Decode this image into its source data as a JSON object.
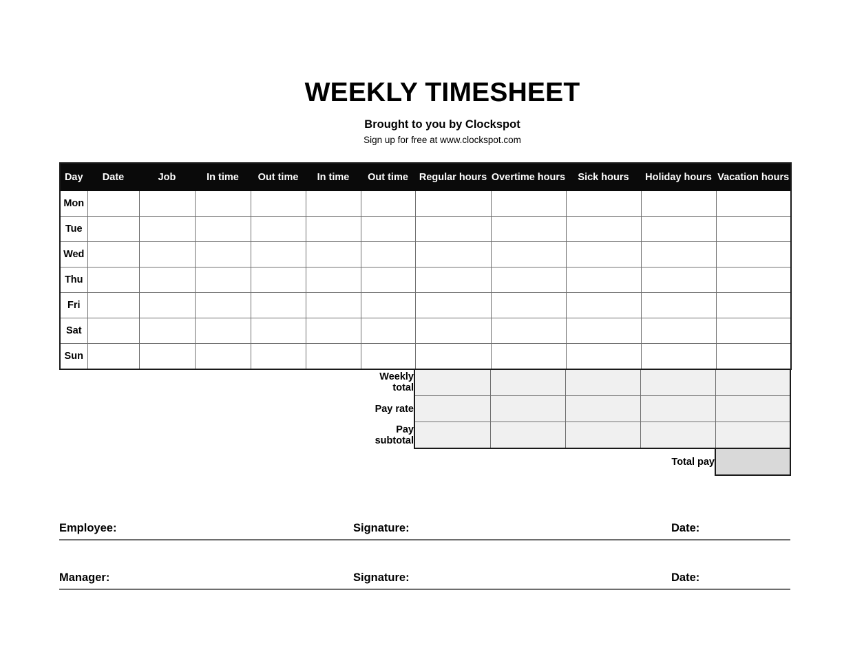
{
  "document": {
    "title": "WEEKLY TIMESHEET",
    "subtitle": "Brought to you by Clockspot",
    "tagline": "Sign up for free at www.clockspot.com"
  },
  "colors": {
    "header_background": "#0a0a0a",
    "header_text": "#ffffff",
    "grid_border": "#6e6e6e",
    "outline_border": "#1a1a1a",
    "summary_cell_fill": "#f0f0f0",
    "total_pay_fill": "#d9d9d9",
    "page_background": "#ffffff"
  },
  "table": {
    "columns": [
      "Day",
      "Date",
      "Job",
      "In time",
      "Out time",
      "In time",
      "Out time",
      "Regular hours",
      "Overtime hours",
      "Sick hours",
      "Holiday hours",
      "Vacation hours"
    ],
    "rows": [
      {
        "day": "Mon",
        "date": "",
        "job": "",
        "in_time_1": "",
        "out_time_1": "",
        "in_time_2": "",
        "out_time_2": "",
        "regular_hours": "",
        "overtime_hours": "",
        "sick_hours": "",
        "holiday_hours": "",
        "vacation_hours": ""
      },
      {
        "day": "Tue",
        "date": "",
        "job": "",
        "in_time_1": "",
        "out_time_1": "",
        "in_time_2": "",
        "out_time_2": "",
        "regular_hours": "",
        "overtime_hours": "",
        "sick_hours": "",
        "holiday_hours": "",
        "vacation_hours": ""
      },
      {
        "day": "Wed",
        "date": "",
        "job": "",
        "in_time_1": "",
        "out_time_1": "",
        "in_time_2": "",
        "out_time_2": "",
        "regular_hours": "",
        "overtime_hours": "",
        "sick_hours": "",
        "holiday_hours": "",
        "vacation_hours": ""
      },
      {
        "day": "Thu",
        "date": "",
        "job": "",
        "in_time_1": "",
        "out_time_1": "",
        "in_time_2": "",
        "out_time_2": "",
        "regular_hours": "",
        "overtime_hours": "",
        "sick_hours": "",
        "holiday_hours": "",
        "vacation_hours": ""
      },
      {
        "day": "Fri",
        "date": "",
        "job": "",
        "in_time_1": "",
        "out_time_1": "",
        "in_time_2": "",
        "out_time_2": "",
        "regular_hours": "",
        "overtime_hours": "",
        "sick_hours": "",
        "holiday_hours": "",
        "vacation_hours": ""
      },
      {
        "day": "Sat",
        "date": "",
        "job": "",
        "in_time_1": "",
        "out_time_1": "",
        "in_time_2": "",
        "out_time_2": "",
        "regular_hours": "",
        "overtime_hours": "",
        "sick_hours": "",
        "holiday_hours": "",
        "vacation_hours": ""
      },
      {
        "day": "Sun",
        "date": "",
        "job": "",
        "in_time_1": "",
        "out_time_1": "",
        "in_time_2": "",
        "out_time_2": "",
        "regular_hours": "",
        "overtime_hours": "",
        "sick_hours": "",
        "holiday_hours": "",
        "vacation_hours": ""
      }
    ]
  },
  "summary": {
    "rows": [
      {
        "label": "Weekly total",
        "regular_hours": "",
        "overtime_hours": "",
        "sick_hours": "",
        "holiday_hours": "",
        "vacation_hours": ""
      },
      {
        "label": "Pay rate",
        "regular_hours": "",
        "overtime_hours": "",
        "sick_hours": "",
        "holiday_hours": "",
        "vacation_hours": ""
      },
      {
        "label": "Pay subtotal",
        "regular_hours": "",
        "overtime_hours": "",
        "sick_hours": "",
        "holiday_hours": "",
        "vacation_hours": ""
      }
    ],
    "total_pay": {
      "label": "Total pay",
      "value": ""
    }
  },
  "signatures": [
    {
      "who_label": "Employee:",
      "who_value": "",
      "signature_label": "Signature:",
      "signature_value": "",
      "date_label": "Date:",
      "date_value": ""
    },
    {
      "who_label": "Manager:",
      "who_value": "",
      "signature_label": "Signature:",
      "signature_value": "",
      "date_label": "Date:",
      "date_value": ""
    }
  ]
}
